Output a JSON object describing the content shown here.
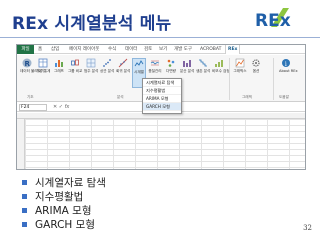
{
  "slide": {
    "title": "REx 시계열분석 메뉴",
    "page_number": "32"
  },
  "logo": {
    "text": "REx"
  },
  "excel": {
    "tabs": [
      "파일",
      "홈",
      "삽입",
      "페이지 레이아웃",
      "수식",
      "데이터",
      "검토",
      "보기",
      "개발 도구",
      "ACROBAT",
      "REx"
    ],
    "active_tab": "REx",
    "name_box": "F24",
    "ribbon_buttons": [
      "데이터 불러오기",
      "기본 통계",
      "그래프",
      "그룹 비교",
      "범주 분석",
      "상관 분석",
      "회귀 분석",
      "시계열",
      "품질관리",
      "다변량",
      "분산 분석",
      "생존 분석",
      "비모수 검정",
      "그래픽스",
      "옵션",
      "About REx"
    ],
    "group_labels": [
      "기초",
      "분석",
      "그래픽",
      "도움말"
    ],
    "dropdown": [
      "시계열자료 탐색",
      "지수평활법",
      "ARIMA 모형",
      "GARCH 모형"
    ]
  },
  "bullets": [
    "시계열자료 탐색",
    "지수평활법",
    "ARIMA 모형",
    "GARCH 모형"
  ]
}
